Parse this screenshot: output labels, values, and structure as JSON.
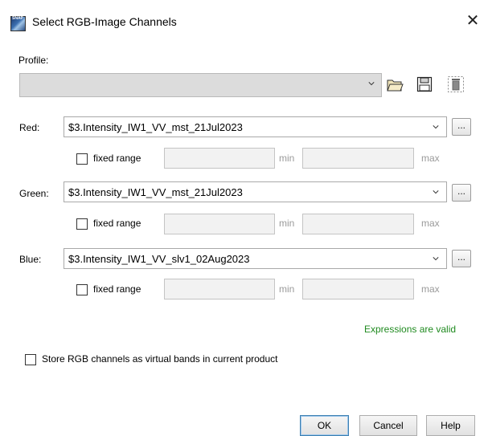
{
  "window": {
    "title": "Select RGB-Image Channels",
    "icon_text": "SNAP",
    "close_glyph": "✕"
  },
  "profile": {
    "label": "Profile:",
    "value": "",
    "icons": [
      "open-folder-icon",
      "save-icon",
      "delete-icon"
    ]
  },
  "channels": [
    {
      "label": "Red:",
      "value": "$3.Intensity_IW1_VV_mst_21Jul2023",
      "fixed_range_label": "fixed range",
      "fixed_range_checked": false,
      "min_label": "min",
      "max_label": "max",
      "min_value": "",
      "max_value": ""
    },
    {
      "label": "Green:",
      "value": "$3.Intensity_IW1_VV_mst_21Jul2023",
      "fixed_range_label": "fixed range",
      "fixed_range_checked": false,
      "min_label": "min",
      "max_label": "max",
      "min_value": "",
      "max_value": ""
    },
    {
      "label": "Blue:",
      "value": "$3.Intensity_IW1_VV_slv1_02Aug2023",
      "fixed_range_label": "fixed range",
      "fixed_range_checked": false,
      "min_label": "min",
      "max_label": "max",
      "min_value": "",
      "max_value": ""
    }
  ],
  "ellipsis_label": "...",
  "status": {
    "text": "Expressions are valid",
    "color": "#1f8a1f"
  },
  "store_virtual": {
    "label": "Store RGB channels as virtual bands in current product",
    "checked": false
  },
  "buttons": {
    "ok": "OK",
    "cancel": "Cancel",
    "help": "Help"
  }
}
